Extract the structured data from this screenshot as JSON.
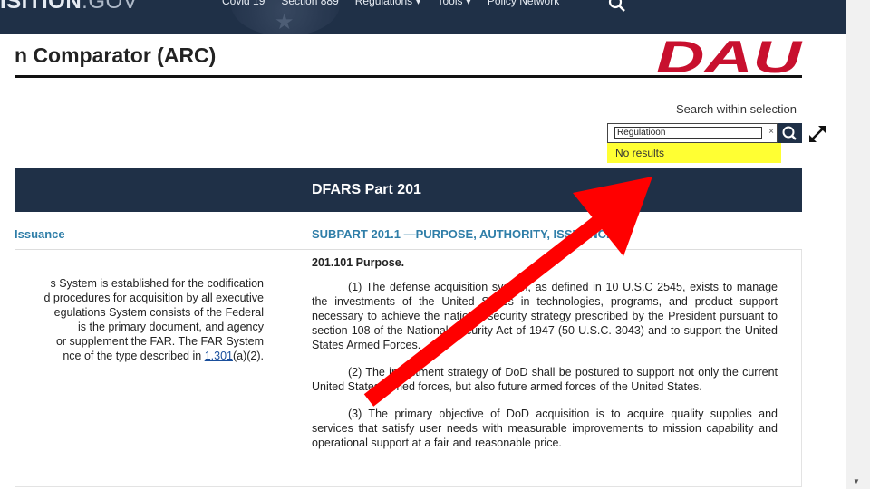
{
  "topnav": {
    "brand_main": "ISITION",
    "brand_suffix": ".GOV",
    "items": [
      "Covid 19",
      "Section 889",
      "Regulations ▾",
      "Tools ▾",
      "Policy Network"
    ]
  },
  "page_title": "n Comparator (ARC)",
  "logo_text": "DAU",
  "search": {
    "label": "Search within selection",
    "value": "Regulatioon",
    "clear": "×",
    "no_results": "No results"
  },
  "band_title": "DFARS Part 201",
  "left": {
    "subpart": "Issuance",
    "lines": [
      "s System is established for the codification",
      "d procedures for acquisition by all executive",
      "egulations System consists of the Federal",
      "is the primary document, and agency",
      "or supplement the FAR. The FAR System"
    ],
    "last_line_before": "nce of the type described in ",
    "link": "1.301",
    "last_line_after": "(a)(2)."
  },
  "right": {
    "subpart": "SUBPART 201.1 —PURPOSE, AUTHORITY, ISSUANCE",
    "section": "201.101  Purpose.",
    "paragraphs": [
      "(1) The defense acquisition system, as defined in 10 U.S.C 2545, exists to manage the investments of the United States in technologies, programs, and product support necessary to achieve the national security strategy prescribed by the President pursuant to section 108 of the National Security Act of 1947 (50 U.S.C. 3043) and to support the United States Armed Forces.",
      "(2) The investment strategy of DoD shall be postured to support not only the current United States armed forces, but also future armed forces of the United States.",
      "(3) The primary objective of DoD acquisition is to acquire quality supplies and services that satisfy user needs with measurable improvements to mission capability and operational support at a fair and reasonable price."
    ]
  },
  "colors": {
    "nav_bg": "#1f3047",
    "accent_link": "#2f7ea8",
    "logo_red": "#c8102e",
    "highlight": "#ffff33",
    "arrow_red": "#ff0000"
  },
  "icons": [
    "search-icon",
    "expand-icon",
    "clear-icon",
    "arrow-annotation",
    "scroll-down-icon"
  ]
}
